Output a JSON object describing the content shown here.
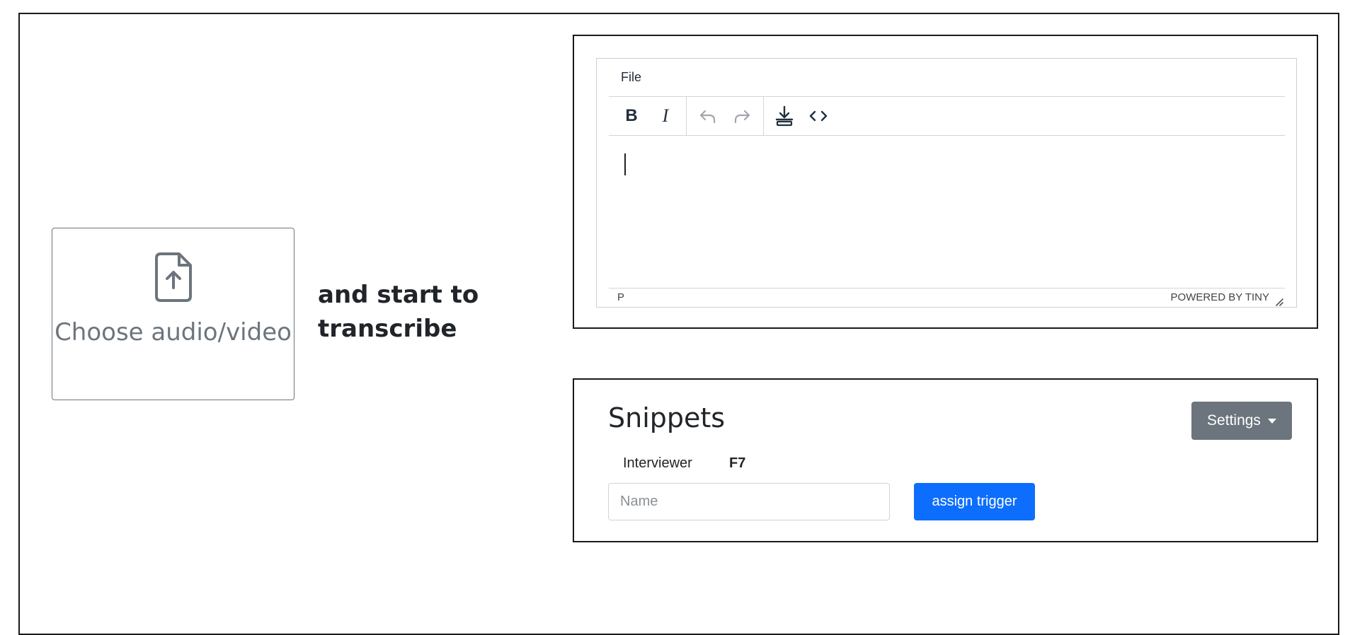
{
  "upload": {
    "label": "Choose audio/video",
    "icon": "file-upload-icon",
    "hint": "and start to transcribe"
  },
  "editor": {
    "menu": {
      "file_label": "File"
    },
    "toolbar": {
      "bold_label": "B",
      "italic_label": "I",
      "icons": [
        "bold-icon",
        "italic-icon",
        "undo-icon",
        "redo-icon",
        "download-icon",
        "code-icon"
      ]
    },
    "content": "",
    "status": {
      "path": "P",
      "branding": "POWERED BY TINY"
    }
  },
  "snippets": {
    "title": "Snippets",
    "settings_label": "Settings",
    "items": [
      {
        "name": "Interviewer",
        "trigger": "F7"
      }
    ],
    "name_placeholder": "Name",
    "assign_label": "assign trigger"
  },
  "colors": {
    "secondary": "#6c757d",
    "primary": "#0d6efd",
    "border": "#1a1a1a"
  }
}
